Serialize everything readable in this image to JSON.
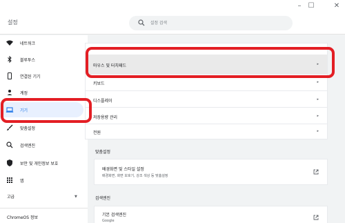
{
  "window": {
    "controls": [
      "minimize-icon",
      "maximize-icon",
      "close-icon"
    ],
    "minimize_glyph": "–",
    "maximize_glyph": "☐",
    "close_glyph": "✕"
  },
  "header": {
    "title": "설정",
    "search_placeholder": "설정 검색"
  },
  "sidebar": {
    "items": [
      {
        "label": "네트워크",
        "icon": "wifi-icon"
      },
      {
        "label": "블루투스",
        "icon": "bluetooth-icon"
      },
      {
        "label": "연결된 기기",
        "icon": "phone-icon"
      },
      {
        "label": "계정",
        "icon": "person-icon"
      },
      {
        "label": "기기",
        "icon": "laptop-icon",
        "active": true
      },
      {
        "label": "맞춤설정",
        "icon": "brush-icon"
      },
      {
        "label": "검색엔진",
        "icon": "search-icon"
      },
      {
        "label": "보안 및 개인정보 보호",
        "icon": "shield-icon"
      },
      {
        "label": "앱",
        "icon": "apps-grid-icon"
      },
      {
        "label": "고급",
        "icon": "none"
      }
    ],
    "advanced_chevron": "▼",
    "about": "ChromeOS 정보"
  },
  "device_section": {
    "rows": [
      {
        "label": "마우스 및 터치패드"
      },
      {
        "label": "키보드"
      },
      {
        "label": "디스플레이"
      },
      {
        "label": "저장용량 관리"
      },
      {
        "label": "전원"
      }
    ],
    "arrow": "▸"
  },
  "personalization": {
    "heading": "맞춤설정",
    "row_title": "배경화면 및 스타일 설정",
    "row_sub": "배경화면, 화면 보호기, 강조 색상 등 맞춤설정"
  },
  "search_engine": {
    "heading": "검색엔진",
    "row_title": "기본 검색엔진",
    "row_sub": "Google"
  },
  "colors": {
    "accent": "#1a73e8",
    "highlight": "#e31e24",
    "active_bg": "#e8f0fe"
  }
}
